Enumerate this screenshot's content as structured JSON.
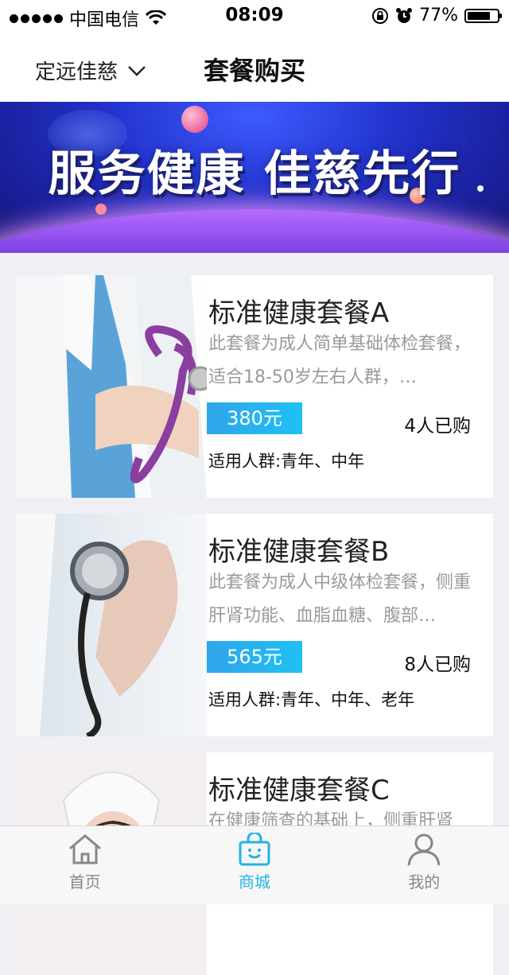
{
  "status_bar": {
    "carrier": "中国电信",
    "time": "08:09",
    "battery_text": "77%",
    "battery_level": 0.77
  },
  "nav": {
    "city": "定远佳慈",
    "title": "套餐购买"
  },
  "banner": {
    "slogan": "服务健康 佳慈先行"
  },
  "packages": [
    {
      "title": "标准健康套餐A",
      "desc": "此套餐为成人简单基础体检套餐，适合18-50岁左右人群，…",
      "price": "380元",
      "bought": "4人已购",
      "target": "适用人群:青年、中年"
    },
    {
      "title": "标准健康套餐B",
      "desc": "此套餐为成人中级体检套餐，侧重肝肾功能、血脂血糖、腹部…",
      "price": "565元",
      "bought": "8人已购",
      "target": "适用人群:青年、中年、老年"
    },
    {
      "title": "标准健康套餐C",
      "desc": "在健康筛查的基础上，侧重肝肾",
      "price": "",
      "bought": "",
      "target": ""
    }
  ],
  "tabbar": {
    "items": [
      {
        "label": "首页",
        "icon": "home-icon",
        "active": false
      },
      {
        "label": "商城",
        "icon": "shopping-bag-icon",
        "active": true
      },
      {
        "label": "我的",
        "icon": "user-icon",
        "active": false
      }
    ],
    "active_color": "#22b3e6",
    "inactive_color": "#888888"
  }
}
